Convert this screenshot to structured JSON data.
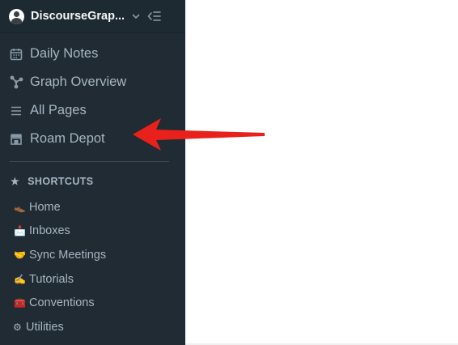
{
  "graph": {
    "name": "DiscourseGrap..."
  },
  "nav": [
    {
      "label": "Daily Notes",
      "icon": "calendar-icon"
    },
    {
      "label": "Graph Overview",
      "icon": "graph-icon"
    },
    {
      "label": "All Pages",
      "icon": "list-icon"
    },
    {
      "label": "Roam Depot",
      "icon": "shop-icon"
    }
  ],
  "shortcuts": {
    "header": "SHORTCUTS",
    "icon": "star-icon",
    "items": [
      {
        "emoji": "👞",
        "label": "Home"
      },
      {
        "emoji": "📩",
        "label": "Inboxes"
      },
      {
        "emoji": "🤝",
        "label": "Sync Meetings"
      },
      {
        "emoji": "✍️",
        "label": "Tutorials"
      },
      {
        "emoji": "🧰",
        "label": "Conventions"
      },
      {
        "emoji": "⚙",
        "label": "Utilities"
      }
    ]
  },
  "annotation": {
    "color": "#e8211c",
    "target": "Roam Depot"
  }
}
